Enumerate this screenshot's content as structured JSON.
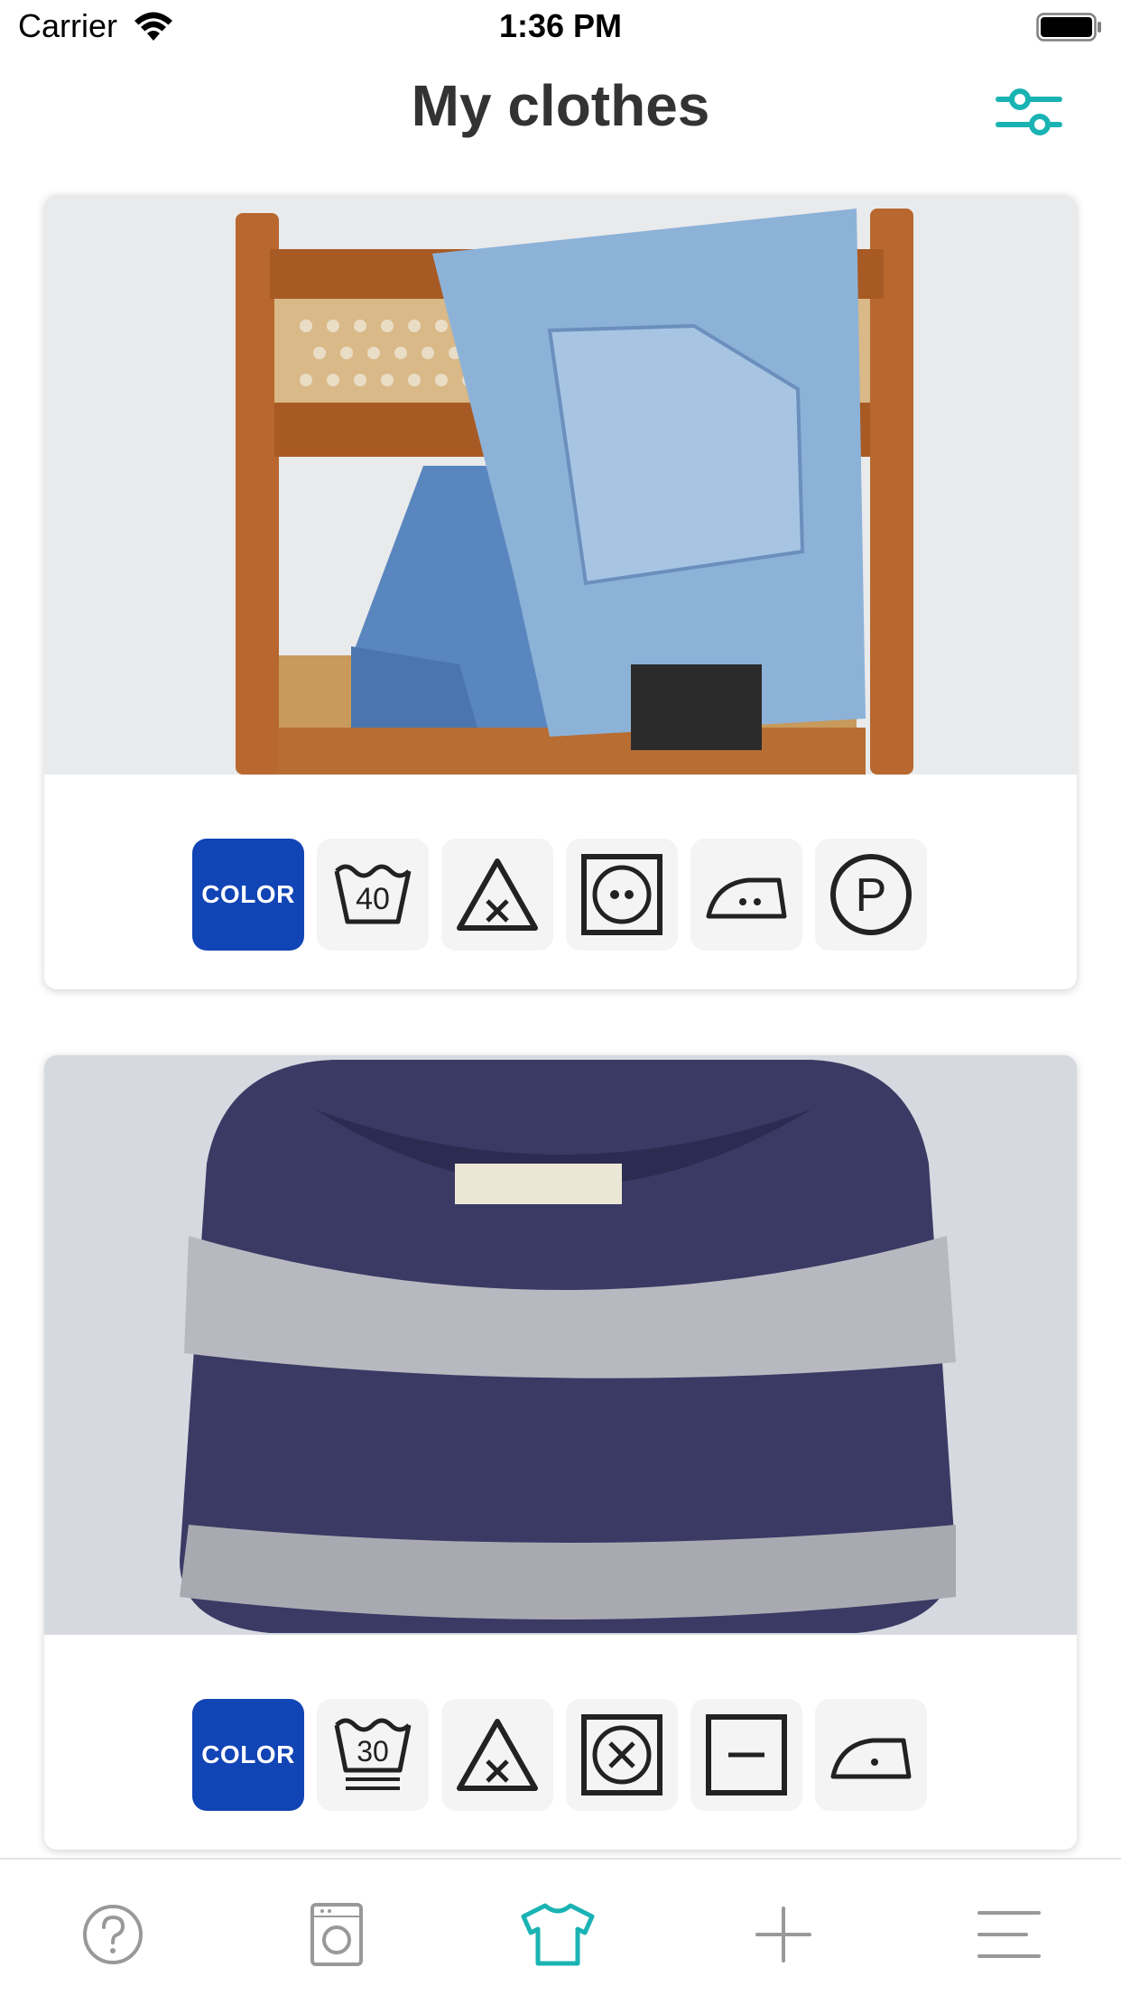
{
  "status_bar": {
    "carrier": "Carrier",
    "time": "1:36 PM"
  },
  "header": {
    "title": "My clothes",
    "filter_icon": "sliders-icon"
  },
  "accent_color": "#1ab3b3",
  "chip_color": "#1144b5",
  "items": [
    {
      "photo": "jeans on a wooden chair",
      "care_symbols": [
        {
          "name": "color-label",
          "label": "COLOR"
        },
        {
          "name": "wash-40-icon",
          "label": "40"
        },
        {
          "name": "do-not-bleach-icon"
        },
        {
          "name": "tumble-dry-low-icon"
        },
        {
          "name": "iron-medium-icon"
        },
        {
          "name": "dry-clean-p-icon",
          "label": "P"
        }
      ]
    },
    {
      "photo": "folded striped knit sweater",
      "care_symbols": [
        {
          "name": "color-label",
          "label": "COLOR"
        },
        {
          "name": "wash-30-gentle-icon",
          "label": "30"
        },
        {
          "name": "do-not-bleach-icon"
        },
        {
          "name": "do-not-tumble-dry-icon"
        },
        {
          "name": "dry-flat-icon"
        },
        {
          "name": "iron-low-icon"
        }
      ]
    }
  ],
  "tab_bar": [
    {
      "name": "help-icon"
    },
    {
      "name": "washing-machine-icon"
    },
    {
      "name": "shirt-icon",
      "active": true
    },
    {
      "name": "add-icon"
    },
    {
      "name": "menu-icon"
    }
  ]
}
